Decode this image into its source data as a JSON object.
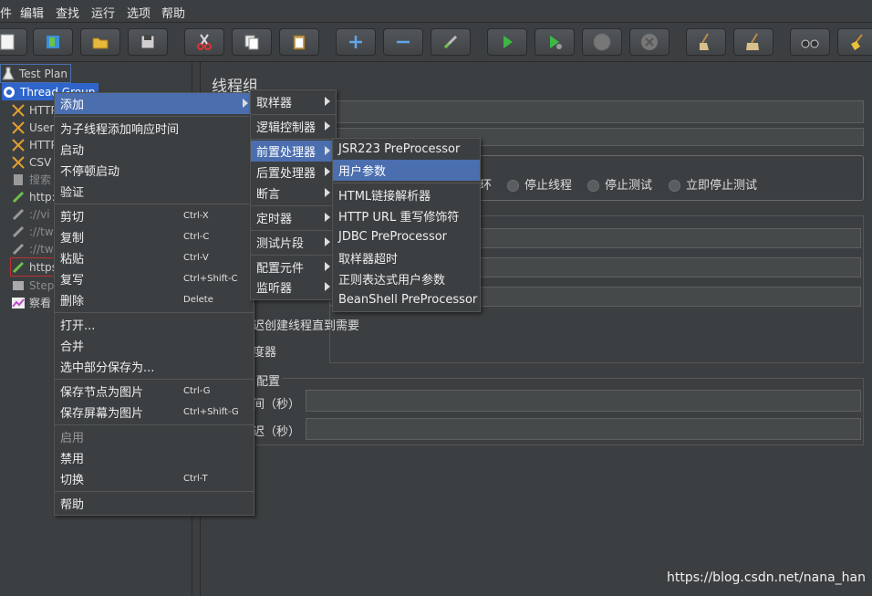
{
  "menubar": [
    "件",
    "编辑",
    "查找",
    "运行",
    "选项",
    "帮助"
  ],
  "toolbar_icons": [
    "new-icon",
    "templates-icon",
    "open-icon",
    "save-icon",
    "cut-icon",
    "copy-icon",
    "paste-icon",
    "expand-icon",
    "collapse-icon",
    "toggle-icon",
    "start-icon",
    "start-no-pause-icon",
    "stop-icon",
    "shutdown-icon",
    "clear-icon",
    "clear-all-icon",
    "search-icon",
    "reset-search-icon"
  ],
  "tree": {
    "test_plan": "Test Plan",
    "thread_group": "Thread Group",
    "items": [
      "HTTP",
      "User",
      "HTTP",
      "CSV",
      "搜索",
      "http:",
      "://vi",
      "://tw",
      "://tw",
      "https",
      "Step",
      "察看"
    ]
  },
  "main": {
    "title": "线程组",
    "radios": [
      "环",
      "停止线程",
      "停止测试",
      "立即停止测试"
    ],
    "delay_create": "迟创建线程直到需要",
    "scheduler": "度器",
    "scheduler_config": "配置",
    "duration": "间（秒）",
    "startup_delay": "迟（秒）"
  },
  "context_menu": {
    "items": [
      {
        "label": "添加",
        "shortcut": ""
      },
      {
        "label": "为子线程添加响应时间",
        "shortcut": ""
      },
      {
        "label": "启动",
        "shortcut": ""
      },
      {
        "label": "不停顿启动",
        "shortcut": ""
      },
      {
        "label": "验证",
        "shortcut": ""
      },
      {
        "label": "剪切",
        "shortcut": "Ctrl-X"
      },
      {
        "label": "复制",
        "shortcut": "Ctrl-C"
      },
      {
        "label": "粘贴",
        "shortcut": "Ctrl-V"
      },
      {
        "label": "复写",
        "shortcut": "Ctrl+Shift-C"
      },
      {
        "label": "删除",
        "shortcut": "Delete"
      },
      {
        "label": "打开...",
        "shortcut": ""
      },
      {
        "label": "合并",
        "shortcut": ""
      },
      {
        "label": "选中部分保存为...",
        "shortcut": ""
      },
      {
        "label": "保存节点为图片",
        "shortcut": "Ctrl-G"
      },
      {
        "label": "保存屏幕为图片",
        "shortcut": "Ctrl+Shift-G"
      },
      {
        "label": "启用",
        "shortcut": ""
      },
      {
        "label": "禁用",
        "shortcut": ""
      },
      {
        "label": "切换",
        "shortcut": "Ctrl-T"
      },
      {
        "label": "帮助",
        "shortcut": ""
      }
    ]
  },
  "add_menu": [
    "取样器",
    "逻辑控制器",
    "前置处理器",
    "后置处理器",
    "断言",
    "定时器",
    "测试片段",
    "配置元件",
    "监听器"
  ],
  "pre_menu": [
    "JSR223 PreProcessor",
    "用户参数",
    "HTML链接解析器",
    "HTTP URL 重写修饰符",
    "JDBC PreProcessor",
    "取样器超时",
    "正则表达式用户参数",
    "BeanShell PreProcessor"
  ],
  "watermark": "https://blog.csdn.net/nana_han",
  "colors": {
    "background": "#3c3f41",
    "selection": "#4b6eaf"
  }
}
